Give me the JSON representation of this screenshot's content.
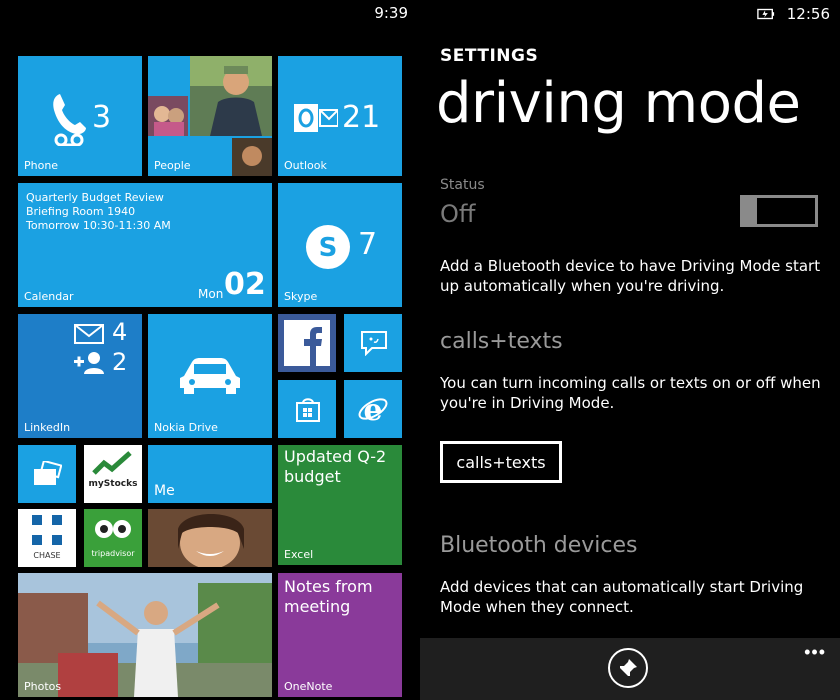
{
  "left": {
    "status_time": "9:39",
    "tiles": {
      "phone": {
        "label": "Phone",
        "count": "3"
      },
      "people": {
        "label": "People"
      },
      "outlook": {
        "label": "Outlook",
        "count": "21"
      },
      "calendar": {
        "label": "Calendar",
        "line1": "Quarterly Budget Review",
        "line2": "Briefing Room 1940",
        "line3": "Tomorrow 10:30-11:30 AM",
        "day": "Mon",
        "date": "02"
      },
      "skype": {
        "label": "Skype",
        "count": "7"
      },
      "linkedin": {
        "label": "LinkedIn",
        "mail_count": "4",
        "contact_count": "2"
      },
      "nokia_drive": {
        "label": "Nokia Drive"
      },
      "mystocks": {
        "label": "myStocks"
      },
      "me": {
        "label": "Me"
      },
      "excel": {
        "label": "Excel",
        "text": "Updated Q-2 budget"
      },
      "chase": {
        "label": "CHASE"
      },
      "tripadvisor": {
        "label": "tripadvisor"
      },
      "photos": {
        "label": "Photos"
      },
      "onenote": {
        "label": "OneNote",
        "text": "Notes from meeting"
      }
    }
  },
  "right": {
    "status_time": "12:56",
    "settings_label": "SETTINGS",
    "title": "driving mode",
    "status_caption": "Status",
    "status_value": "Off",
    "desc_status": "Add a Bluetooth device to have Driving Mode start up automatically when you're driving.",
    "calls_head": "calls+texts",
    "desc_calls": "You can turn incoming calls or texts on or off when you're in Driving Mode.",
    "calls_button": "calls+texts",
    "bt_head": "Bluetooth devices",
    "desc_bt": "Add devices that can automatically start Driving Mode when they connect.",
    "more_label": "•••"
  },
  "colors": {
    "tile_cyan": "#1ba1e2",
    "tile_blue": "#1e7ec8",
    "excel_green": "#2a8a3a",
    "onenote_purple": "#8a3a9a",
    "app_bar": "#1f1f1f"
  }
}
